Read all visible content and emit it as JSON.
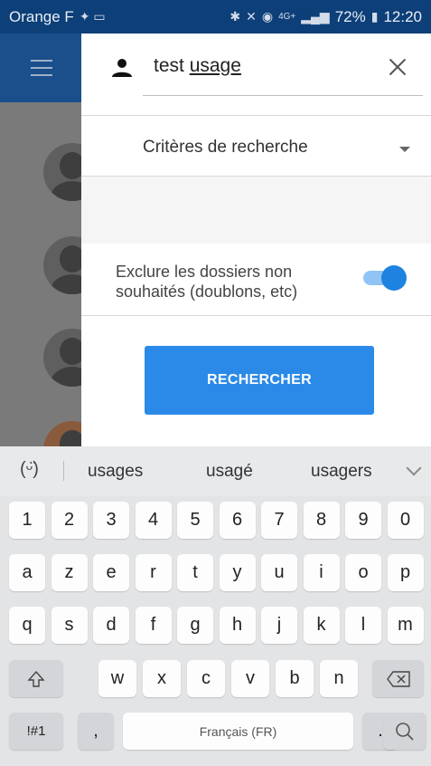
{
  "status_bar": {
    "carrier": "Orange F",
    "battery": "72%",
    "time": "12:20",
    "network": "4G+"
  },
  "drawer": {
    "search_value_prefix": "test",
    "search_value_underlined": "usage",
    "criteria_label": "Critères de recherche",
    "exclude_label": "Exclure les dossiers non souhaités (doublons, etc)",
    "exclude_toggle_on": true,
    "search_button": "RECHERCHER"
  },
  "keyboard": {
    "suggestions": [
      "usages",
      "usagé",
      "usagers"
    ],
    "row1": [
      "1",
      "2",
      "3",
      "4",
      "5",
      "6",
      "7",
      "8",
      "9",
      "0"
    ],
    "row2": [
      "a",
      "z",
      "e",
      "r",
      "t",
      "y",
      "u",
      "i",
      "o",
      "p"
    ],
    "row3": [
      "q",
      "s",
      "d",
      "f",
      "g",
      "h",
      "j",
      "k",
      "l",
      "m"
    ],
    "row4": [
      "w",
      "x",
      "c",
      "v",
      "b",
      "n"
    ],
    "symbols_key": "!#1",
    "comma_key": ",",
    "space_label": "Français (FR)",
    "period_key": "."
  },
  "colors": {
    "status_bar": "#0d3f78",
    "app_bar": "#1a4f8c",
    "accent": "#2b8ae8"
  }
}
